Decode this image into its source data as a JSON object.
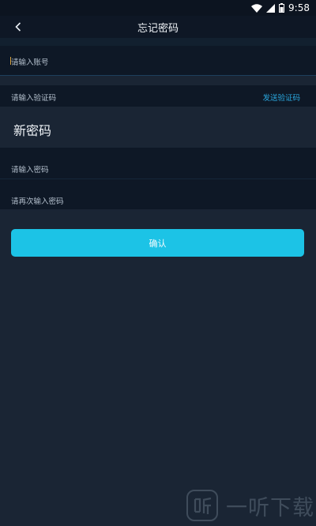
{
  "status_bar": {
    "time": "9:58"
  },
  "header": {
    "title": "忘记密码",
    "back_icon": "chevron-left-icon"
  },
  "account_section": {
    "account_placeholder": "请输入账号",
    "code_placeholder": "请输入验证码",
    "send_code_label": "发送验证码"
  },
  "password_section": {
    "title": "新密码",
    "password_placeholder": "请输入密码",
    "confirm_password_placeholder": "请再次输入密码"
  },
  "actions": {
    "confirm_label": "确认"
  },
  "watermark": {
    "text": "一听下载",
    "logo_glyph": "听"
  },
  "colors": {
    "background": "#1a2534",
    "field_background": "#0e1826",
    "accent": "#1cc3e6",
    "link": "#2aa7de"
  }
}
